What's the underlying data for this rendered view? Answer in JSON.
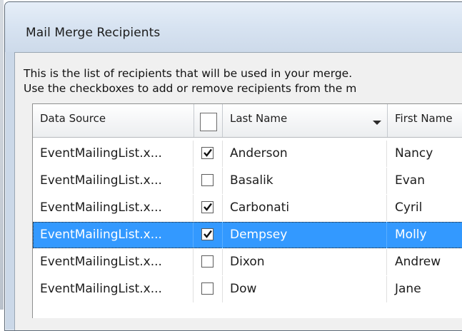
{
  "dialog": {
    "title": "Mail Merge Recipients",
    "instruction_line1": "This is the list of recipients that will be used in your merge.",
    "instruction_line2": "Use the checkboxes to add or remove recipients from the m"
  },
  "grid": {
    "columns": [
      "Data Source",
      "",
      "Last Name",
      "First Name"
    ],
    "sorted_column": "Last Name",
    "rows": [
      {
        "source": "EventMailingList.x...",
        "checked": true,
        "last": "Anderson",
        "first": "Nancy",
        "selected": false
      },
      {
        "source": "EventMailingList.x...",
        "checked": false,
        "last": "Basalik",
        "first": "Evan",
        "selected": false
      },
      {
        "source": "EventMailingList.x...",
        "checked": true,
        "last": "Carbonati",
        "first": "Cyril",
        "selected": false
      },
      {
        "source": "EventMailingList.x...",
        "checked": true,
        "last": "Dempsey",
        "first": "Molly",
        "selected": true
      },
      {
        "source": "EventMailingList.x...",
        "checked": false,
        "last": "Dixon",
        "first": "Andrew",
        "selected": false
      },
      {
        "source": "EventMailingList.x...",
        "checked": false,
        "last": "Dow",
        "first": "Jane",
        "selected": false
      }
    ]
  },
  "colors": {
    "selection": "#3399ff",
    "selection_text": "#ffffff"
  }
}
